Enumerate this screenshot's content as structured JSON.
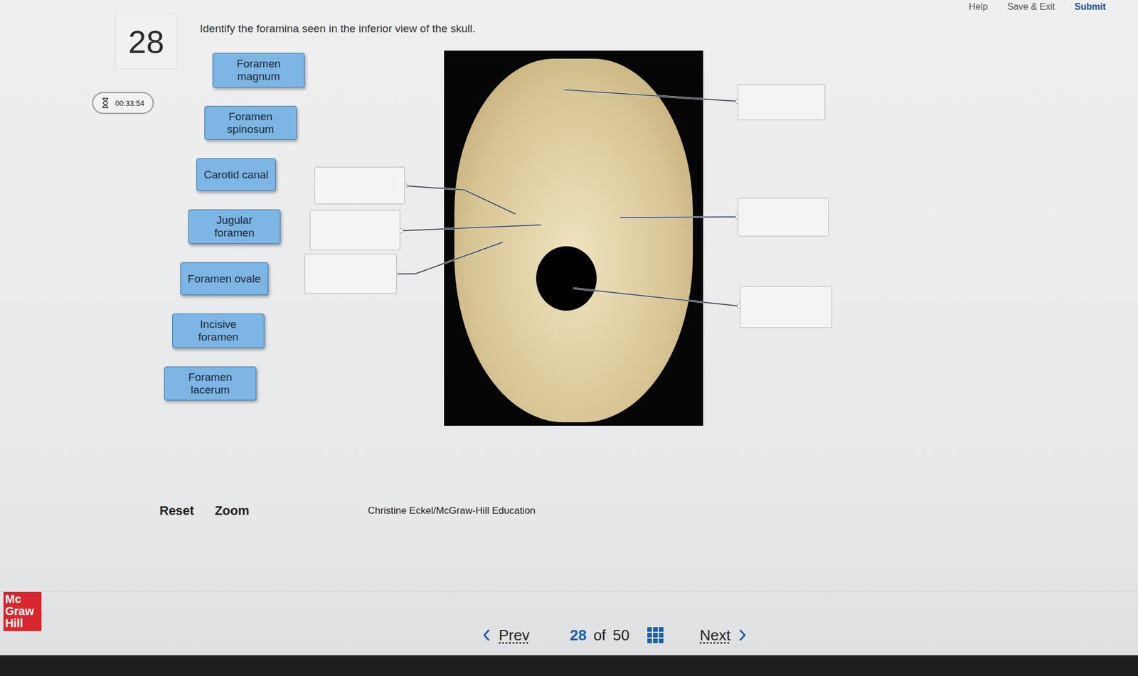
{
  "header": {
    "links": [
      "Help",
      "Save & Exit",
      "Submit"
    ]
  },
  "question": {
    "number": "28",
    "timer": "00:33:54",
    "prompt": "Identify the foramina seen in the inferior view of the skull."
  },
  "labels": [
    "Foramen magnum",
    "Foramen spinosum",
    "Carotid canal",
    "Jugular foramen",
    "Foramen ovale",
    "Incisive foramen",
    "Foramen lacerum"
  ],
  "figure": {
    "credit": "Christine Eckel/McGraw-Hill Education",
    "drop_zones": [
      {
        "filled": false
      },
      {
        "filled": false
      },
      {
        "filled": false
      },
      {
        "filled": false
      },
      {
        "filled": false
      },
      {
        "filled": false
      }
    ]
  },
  "tools": [
    "Reset",
    "Zoom"
  ],
  "pagination": {
    "prev": "Prev",
    "current": "28",
    "of": "of",
    "total": "50",
    "next": "Next"
  },
  "logo": [
    "Mc",
    "Graw",
    "Hill"
  ]
}
